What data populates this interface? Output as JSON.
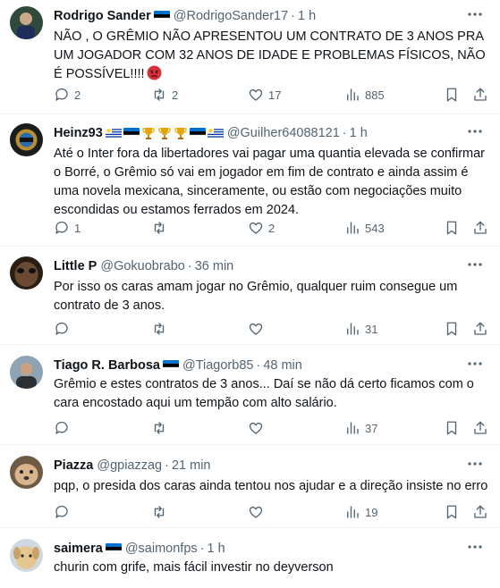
{
  "tweets": [
    {
      "name": "Rodrigo Sander",
      "handle": "@RodrigoSander17",
      "time": "1 h",
      "text": "NÃO , O GRÊMIO NÃO APRESENTOU UM CONTRATO DE 3 ANOS PRA UM JOGADOR COM 32 ANOS DE IDADE E PROBLEMAS FÍSICOS, NÃO É POSSÍVEL!!!!",
      "replies": "2",
      "retweets": "2",
      "likes": "17",
      "views": "885",
      "badges": [
        "estonia-flag"
      ]
    },
    {
      "name": "Heinz93",
      "handle": "@Guilher64088121",
      "time": "1 h",
      "text": "Até o Inter fora da libertadores vai pagar uma quantia elevada se confirmar o Borré, o Grêmio só vai em jogador em fim de contrato e ainda assim é uma novela mexicana, sinceramente, ou estão com negociações muito escondidas ou estamos ferrados em 2024.",
      "replies": "1",
      "retweets": "",
      "likes": "2",
      "views": "543",
      "badges": [
        "uruguay-flag",
        "estonia-flag",
        "trophy",
        "trophy",
        "trophy",
        "estonia-flag",
        "uruguay-flag"
      ]
    },
    {
      "name": "Little P",
      "handle": "@Gokuobrabo",
      "time": "36 min",
      "text": "Por isso os caras amam jogar no Grêmio, qualquer ruim consegue um contrato de 3 anos.",
      "replies": "",
      "retweets": "",
      "likes": "",
      "views": "31",
      "badges": []
    },
    {
      "name": "Tiago R. Barbosa",
      "handle": "@Tiagorb85",
      "time": "48 min",
      "text": "Grêmio e estes contratos de 3 anos... Daí se não dá certo ficamos com o cara encostado aqui um tempão com alto salário.",
      "replies": "",
      "retweets": "",
      "likes": "",
      "views": "37",
      "badges": [
        "estonia-flag"
      ]
    },
    {
      "name": "Piazza",
      "handle": "@gpiazzag",
      "time": "21 min",
      "text": "pqp, o presida dos caras ainda tentou nos ajudar e a direção insiste no erro",
      "replies": "",
      "retweets": "",
      "likes": "",
      "views": "19",
      "badges": []
    },
    {
      "name": "saimera",
      "handle": "@saimonfps",
      "time": "1 h",
      "text": "churin com grife, mais fácil investir no deyverson",
      "replies": "",
      "retweets": "",
      "likes": "",
      "views": "",
      "badges": [
        "estonia-flag"
      ]
    }
  ],
  "separator": "·",
  "emoji": {
    "angry": "angry-face-icon"
  },
  "colors": {
    "text": "#0f1419",
    "muted": "#536471",
    "border": "#eff3f4",
    "estonia_blue": "#0072ce",
    "uruguay_blue": "#0038a8",
    "trophy": "#e5a50a"
  }
}
